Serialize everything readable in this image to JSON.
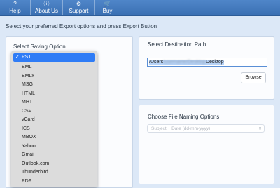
{
  "toolbar": {
    "items": [
      {
        "label": "Help",
        "icon": "question-icon"
      },
      {
        "label": "About Us",
        "icon": "info-icon"
      },
      {
        "label": "Support",
        "icon": "gear-icon"
      },
      {
        "label": "Buy",
        "icon": "cart-icon"
      }
    ]
  },
  "instruction": "Select your preferred Export options and press Export Button",
  "saving": {
    "title": "Select Saving Option",
    "options": [
      "PST",
      "EML",
      "EMLx",
      "MSG",
      "HTML",
      "MHT",
      "CSV",
      "vCard",
      "ICS",
      "MBOX",
      "Yahoo",
      "Gmail",
      "Outlook.com",
      "Thunderbird",
      "PDF"
    ],
    "selected": "PST"
  },
  "destination": {
    "title": "Select Destination Path",
    "path_prefix": "/Users",
    "path_blurred": "/username/Desktop",
    "path_suffix": "Desktop",
    "browse_label": "Browse"
  },
  "naming": {
    "title": "Choose File Naming Options",
    "placeholder": "Subject + Date (dd-mm-yyyy)"
  },
  "colors": {
    "toolbar": "#3a6fb2",
    "background": "#dce8f7",
    "selection": "#2f7cf6"
  }
}
